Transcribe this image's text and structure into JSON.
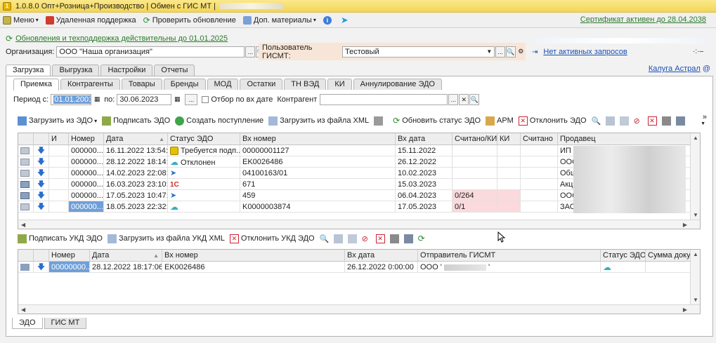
{
  "window": {
    "title": "1.0.8.0 Опт+Розница+Производство | Обмен с ГИС МТ |"
  },
  "menubar": {
    "menu": "Меню",
    "support": "Удаленная поддержка",
    "check_update": "Проверить обновление",
    "materials": "Доп. материалы",
    "certificate": "Сертификат активен до 28.04.2038"
  },
  "update_notice": "Обновления и техподдержка действительны до 01.01.2025",
  "org": {
    "label": "Организация:",
    "value": "ООО \"Наша организация\""
  },
  "gismt": {
    "label": "Пользователь ГИСМТ:",
    "value": "Тестовый"
  },
  "requests": {
    "text": "Нет активных запросов",
    "arrows": "·:·–"
  },
  "top_tabs": [
    "Загрузка",
    "Выгрузка",
    "Настройки",
    "Отчеты"
  ],
  "kaluga": "Калуга Астрал",
  "sub_tabs": [
    "Приемка",
    "Контрагенты",
    "Товары",
    "Бренды",
    "МОД",
    "Остатки",
    "ТН ВЭД",
    "КИ",
    "Аннулирование ЭДО"
  ],
  "period": {
    "label": "Период с:",
    "from": "01.01.2001",
    "to_label": "по:",
    "to": "30.06.2023",
    "dots": "...",
    "checkbox_label": "Отбор по вх дате",
    "contractor_label": "Контрагент"
  },
  "toolbar1": {
    "load_edo": "Загрузить из ЭДО",
    "sign_edo": "Подписать ЭДО",
    "create_receipt": "Создать поступление",
    "load_xml": "Загрузить из файла XML",
    "update_status": "Обновить статус ЭДО",
    "arm": "АРМ",
    "reject_edo": "Отклонить ЭДО",
    "more": "»"
  },
  "table1": {
    "headers": [
      "И",
      "Номер",
      "Дата",
      "Статус ЭДО",
      "Вх номер",
      "Вх дата",
      "Считано/КИ",
      "КИ",
      "Считано",
      "Продавец"
    ],
    "rows": [
      {
        "num": "000000...",
        "date": "16.11.2022 13:54:...",
        "status": "Требуется подп...",
        "status_icon": "sign-required-icon",
        "in_num": "00000001127",
        "in_date": "15.11.2022",
        "read_ki": "",
        "seller": "ИП",
        "doc_icon": "document-icon"
      },
      {
        "num": "000000...",
        "date": "28.12.2022 18:14:...",
        "status": "Отклонен",
        "status_icon": "cloud-icon",
        "in_num": "EK0026486",
        "in_date": "26.12.2022",
        "read_ki": "",
        "seller": "ООС",
        "doc_icon": "document-icon"
      },
      {
        "num": "000000...",
        "date": "14.02.2023 22:08:...",
        "status": "",
        "status_icon": "operator-icon",
        "in_num": "04100163/01",
        "in_date": "10.02.2023",
        "read_ki": "",
        "seller": "Общ",
        "doc_icon": "document-icon"
      },
      {
        "num": "000000...",
        "date": "16.03.2023 23:10:...",
        "status": "",
        "status_icon": "1c-icon",
        "in_num": "671",
        "in_date": "15.03.2023",
        "read_ki": "",
        "seller": "Акц",
        "doc_icon": "document-posted-icon"
      },
      {
        "num": "000000...",
        "date": "17.05.2023 10:47:...",
        "status": "",
        "status_icon": "operator-icon",
        "in_num": "459",
        "in_date": "06.04.2023",
        "read_ki": "0/264",
        "seller": "ООС",
        "doc_icon": "document-posted-icon"
      },
      {
        "num": "000000...",
        "date": "18.05.2023 22:32:...",
        "status": "",
        "status_icon": "cloud-icon",
        "in_num": "K0000003874",
        "in_date": "17.05.2023",
        "read_ki": "0/1",
        "seller": "ЗАО",
        "doc_icon": "document-icon"
      }
    ],
    "right_edge": [
      "",
      "",
      "С",
      "П",
      "",
      "Е"
    ]
  },
  "toolbar2": {
    "sign_ukd": "Подписать УКД ЭДО",
    "load_ukd_xml": "Загрузить из файла УКД XML",
    "reject_ukd": "Отклонить УКД ЭДО"
  },
  "table2": {
    "headers": [
      "Номер",
      "Дата",
      "Вх номер",
      "Вх дата",
      "Отправитель ГИСМТ",
      "Статус ЭДО",
      "Сумма доку"
    ],
    "rows": [
      {
        "num": "00000000...",
        "date": "28.12.2022 18:17:06",
        "in_num": "EK0026486",
        "in_date": "26.12.2022 0:00:00",
        "sender": "ООО '",
        "sender_end": "'"
      }
    ]
  },
  "bottom_tabs": [
    "ЭДО",
    "ГИС МТ"
  ]
}
